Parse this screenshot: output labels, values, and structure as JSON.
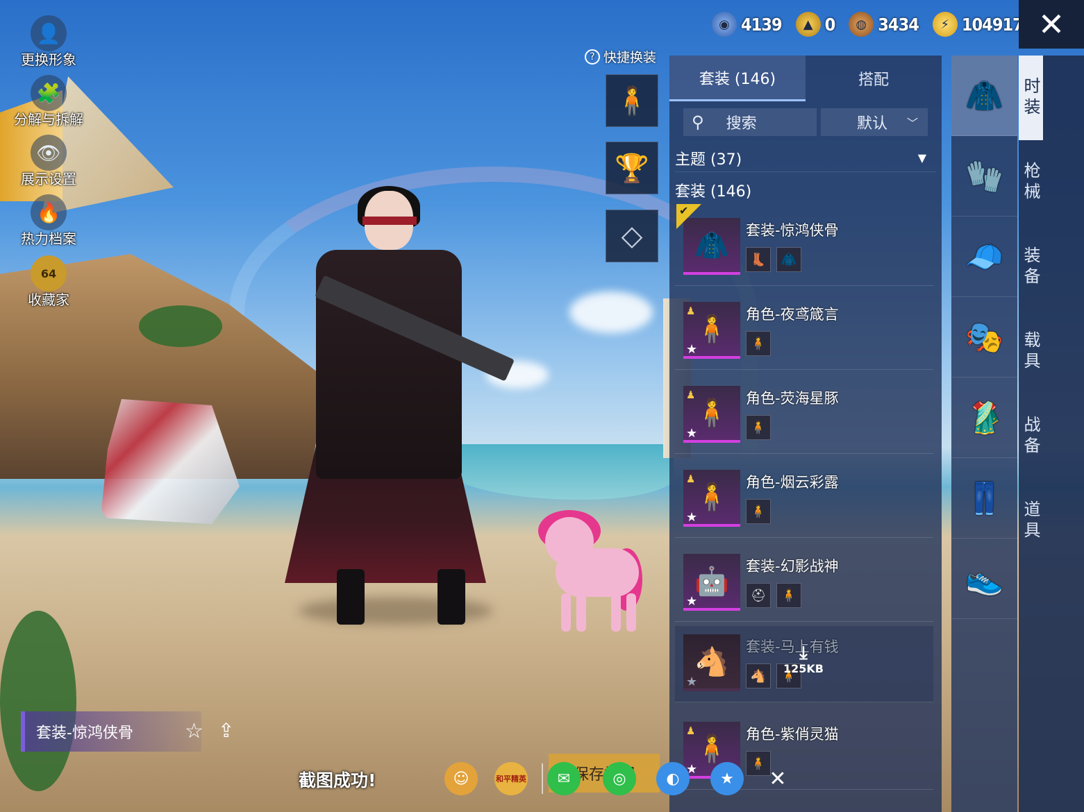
{
  "left_menu": [
    {
      "label": "更换形象",
      "icon": "avatar-icon"
    },
    {
      "label": "分解与拆解",
      "icon": "puzzle-icon"
    },
    {
      "label": "展示设置",
      "icon": "eye-icon"
    },
    {
      "label": "热力档案",
      "icon": "flame-icon"
    },
    {
      "label": "收藏家",
      "icon": "collector-badge-icon",
      "badge": "64"
    }
  ],
  "currency": [
    {
      "value": "4139",
      "color": "#3b6fc9"
    },
    {
      "value": "0",
      "color": "#d8a21e"
    },
    {
      "value": "3434",
      "color": "#c6782f"
    },
    {
      "value": "104917",
      "color": "#f2c230"
    }
  ],
  "quick_outfit": {
    "title": "快捷换装",
    "help": "?"
  },
  "panel": {
    "tabs": [
      "套装 (146)",
      "搭配"
    ],
    "search_label": "搜索",
    "sort_label": "默认",
    "group_theme": "主题 (37)",
    "group_suits": "套装 (146)",
    "items": [
      {
        "name": "套装-惊鸿侠骨",
        "selected": true
      },
      {
        "name": "角色-夜鸢箴言"
      },
      {
        "name": "角色-荧海星豚"
      },
      {
        "name": "角色-烟云彩露"
      },
      {
        "name": "套装-幻影战神"
      },
      {
        "name": "套装-马上有钱",
        "download_size": "125KB"
      },
      {
        "name": "角色-紫俏灵猫"
      }
    ]
  },
  "side_tabs": [
    "时装",
    "枪械",
    "装备",
    "载具",
    "战备",
    "道具"
  ],
  "bottom": {
    "outfit_name": "套装-惊鸿侠骨",
    "save_label": "保存搭配",
    "toast": "截图成功!",
    "badge_text": "和平精英"
  }
}
